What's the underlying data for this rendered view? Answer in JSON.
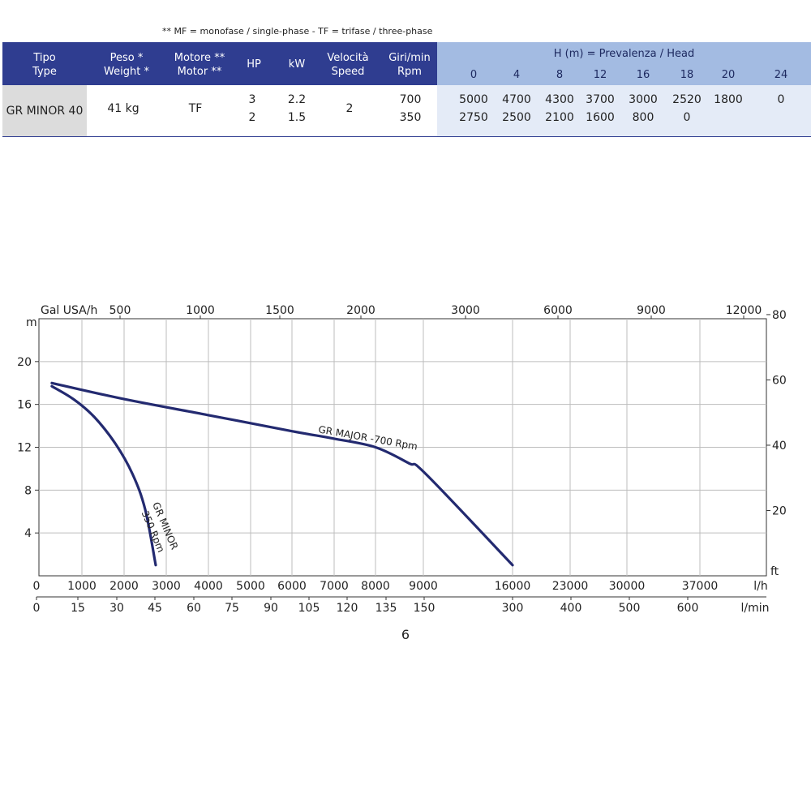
{
  "note": "** MF = monofase / single-phase - TF = trifase / three-phase",
  "table": {
    "headers": [
      {
        "l1": "Tipo",
        "l2": "Type"
      },
      {
        "l1": "Peso *",
        "l2": "Weight *"
      },
      {
        "l1": "Motore **",
        "l2": "Motor **"
      },
      {
        "l1": "HP",
        "l2": ""
      },
      {
        "l1": "kW",
        "l2": ""
      },
      {
        "l1": "Velocità",
        "l2": "Speed"
      },
      {
        "l1": "Giri/min",
        "l2": "Rpm"
      }
    ],
    "head_title": "H (m) = Prevalenza / Head",
    "head_values": [
      "0",
      "4",
      "8",
      "12",
      "16",
      "18",
      "20",
      "24"
    ],
    "row": {
      "type": "GR  MINOR 40",
      "weight": "41 kg",
      "motor": "TF",
      "hp": [
        "3",
        "2"
      ],
      "kw": [
        "2.2",
        "1.5"
      ],
      "speed": "2",
      "rpm": [
        "700",
        "350"
      ],
      "flow": [
        [
          "5000",
          "4700",
          "4300",
          "3700",
          "3000",
          "2520",
          "1800",
          "0"
        ],
        [
          "2750",
          "2500",
          "2100",
          "1600",
          "800",
          "0",
          "",
          ""
        ]
      ]
    }
  },
  "chart_data": {
    "type": "line",
    "units": {
      "y_left": "m",
      "y_right": "ft",
      "x_top": "Gal USA/h",
      "x_main": "l/h",
      "x_bottom": "l/min"
    },
    "y_left_ticks": [
      "4",
      "8",
      "12",
      "16",
      "20"
    ],
    "y_right_ticks": [
      "20",
      "40",
      "60",
      "80"
    ],
    "x_top_ticks": [
      "500",
      "1000",
      "1500",
      "2000",
      "3000",
      "6000",
      "9000",
      "12000"
    ],
    "x_main_ticks": [
      "0",
      "1000",
      "2000",
      "3000",
      "4000",
      "5000",
      "6000",
      "7000",
      "8000",
      "9000",
      "16000",
      "23000",
      "30000",
      "37000"
    ],
    "x_bottom_ticks": [
      "0",
      "15",
      "30",
      "45",
      "60",
      "75",
      "90",
      "105",
      "120",
      "135",
      "150",
      "300",
      "400",
      "500",
      "600"
    ],
    "ylim": [
      0,
      24
    ],
    "series": [
      {
        "name": "GR MAJOR -700 Rpm",
        "color": "#232a70",
        "points": [
          [
            300,
            18
          ],
          [
            2000,
            16.5
          ],
          [
            4000,
            15
          ],
          [
            6000,
            13.5
          ],
          [
            7000,
            12.8
          ],
          [
            8000,
            12
          ],
          [
            8700,
            10.5
          ],
          [
            9200,
            9.5
          ],
          [
            16000,
            1
          ]
        ]
      },
      {
        "name": "GR MINOR 350 Rpm",
        "color": "#232a70",
        "points": [
          [
            300,
            17.7
          ],
          [
            800,
            16.5
          ],
          [
            1300,
            14.8
          ],
          [
            1800,
            12.3
          ],
          [
            2200,
            9.5
          ],
          [
            2500,
            6.2
          ],
          [
            2750,
            1
          ]
        ]
      }
    ]
  },
  "page_number": "6"
}
